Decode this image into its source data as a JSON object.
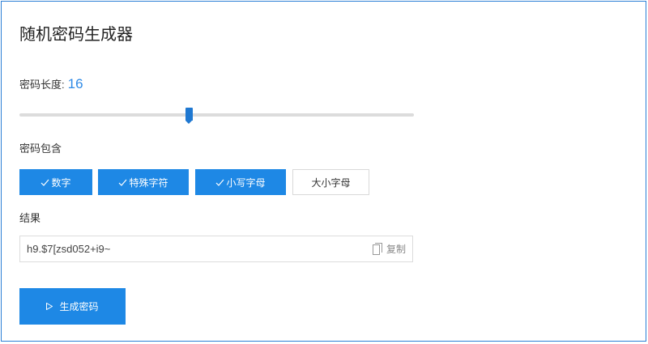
{
  "title": "随机密码生成器",
  "length": {
    "label": "密码长度:",
    "value": "16",
    "slider_fraction": 0.43
  },
  "include": {
    "label": "密码包含",
    "options": [
      {
        "label": "数字",
        "checked": true
      },
      {
        "label": "特殊字符",
        "checked": true
      },
      {
        "label": "小写字母",
        "checked": true
      },
      {
        "label": "大小字母",
        "checked": false
      }
    ]
  },
  "result": {
    "label": "结果",
    "value": "h9.$7[zsd052+i9~",
    "copy_label": "复制"
  },
  "generate_label": "生成密码",
  "colors": {
    "accent": "#1e88e5",
    "value_text": "#2e8ae6",
    "border": "#2b7fd6"
  },
  "icons": {
    "check": "check-icon",
    "copy": "copy-icon",
    "play": "play-icon"
  }
}
